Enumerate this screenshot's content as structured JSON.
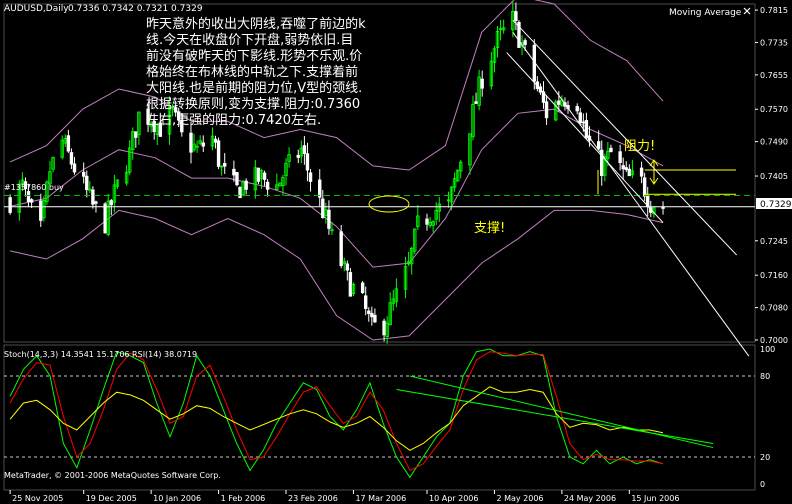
{
  "main_panel": {
    "symbol": "AUDUSD,Daily",
    "ohlc": "0.7336 0.7342 0.7321 0.7329",
    "indicator_label": "Moving Average",
    "close_icon": "close-icon",
    "order_label": "#1357860 buy",
    "price_tag": "0.7329",
    "annotation_lines": [
      "昨天意外的收出大阴线,吞噬了前边的k",
      "线.今天在收盘价下开盘,弱势依旧.目",
      "前没有破昨天的下影线.形势不乐观.价",
      "格始终在布林线的中轨之下.支撑着前",
      "大阳线.也是前期的阻力位,V型的颈线.",
      "根据转换原则,变为支撑.阻力:0.7360",
      "左右,更强的阻力:0.7420左右."
    ],
    "resistance_label": "阻力!",
    "support_label": "支撑!"
  },
  "sub_panel": {
    "header": "Stoch(14,3,3) 14.3541 15.1706  RSI(14) 38.0719",
    "copyright": "MetaTrader, © 2001-2006 MetaQuotes Software Corp."
  },
  "colors": {
    "background": "#000000",
    "bull": "#00ff00",
    "bear": "#ffffff",
    "bollinger": "#c080c0",
    "trendline": "#ffffff",
    "level_line": "#ffff00",
    "stoch_main": "#00ff00",
    "stoch_signal": "#ff0000",
    "rsi": "#ffff00",
    "annotation": "#ffffff",
    "callout": "#ffff00",
    "axis_text": "#ffffff",
    "grid_dotted": "#c8c8c8",
    "order_line": "#00c000"
  },
  "chart_data": [
    {
      "type": "candlestick",
      "title": "AUDUSD,Daily",
      "price_ticks": [
        "0.7815",
        "0.7735",
        "0.7655",
        "0.7570",
        "0.7490",
        "0.7405",
        "0.7329",
        "0.7245",
        "0.7160",
        "0.7080",
        "0.7000"
      ],
      "date_ticks": [
        "25 Nov 2005",
        "19 Dec 2005",
        "10 Jan 2006",
        "1 Feb 2006",
        "23 Feb 2006",
        "17 Mar 2006",
        "10 Apr 2006",
        "2 May 2006",
        "24 May 2006",
        "15 Jun 2006"
      ],
      "ylim": [
        0.6995,
        0.783
      ],
      "last_price": 0.7329,
      "order_price": 0.7357,
      "resistance_levels": [
        0.742,
        0.736
      ],
      "support_level": 0.7329,
      "close_path": [
        {
          "date": "2005-11-25",
          "close": 0.7345
        },
        {
          "date": "2005-11-29",
          "close": 0.738
        },
        {
          "date": "2005-12-01",
          "close": 0.733
        },
        {
          "date": "2005-12-05",
          "close": 0.727
        },
        {
          "date": "2005-12-08",
          "close": 0.742
        },
        {
          "date": "2005-12-12",
          "close": 0.749
        },
        {
          "date": "2005-12-15",
          "close": 0.744
        },
        {
          "date": "2005-12-19",
          "close": 0.738
        },
        {
          "date": "2005-12-22",
          "close": 0.733
        },
        {
          "date": "2005-12-26",
          "close": 0.729
        },
        {
          "date": "2005-12-29",
          "close": 0.736
        },
        {
          "date": "2006-01-03",
          "close": 0.746
        },
        {
          "date": "2006-01-06",
          "close": 0.7555
        },
        {
          "date": "2006-01-10",
          "close": 0.755
        },
        {
          "date": "2006-01-13",
          "close": 0.7525
        },
        {
          "date": "2006-01-17",
          "close": 0.756
        },
        {
          "date": "2006-01-20",
          "close": 0.75
        },
        {
          "date": "2006-01-25",
          "close": 0.747
        },
        {
          "date": "2006-01-30",
          "close": 0.75
        },
        {
          "date": "2006-02-02",
          "close": 0.742
        },
        {
          "date": "2006-02-07",
          "close": 0.737
        },
        {
          "date": "2006-02-10",
          "close": 0.739
        },
        {
          "date": "2006-02-15",
          "close": 0.74
        },
        {
          "date": "2006-02-20",
          "close": 0.738
        },
        {
          "date": "2006-02-23",
          "close": 0.742
        },
        {
          "date": "2006-02-28",
          "close": 0.747
        },
        {
          "date": "2006-03-03",
          "close": 0.74
        },
        {
          "date": "2006-03-07",
          "close": 0.732
        },
        {
          "date": "2006-03-10",
          "close": 0.725
        },
        {
          "date": "2006-03-15",
          "close": 0.715
        },
        {
          "date": "2006-03-20",
          "close": 0.709
        },
        {
          "date": "2006-03-23",
          "close": 0.703
        },
        {
          "date": "2006-03-27",
          "close": 0.704
        },
        {
          "date": "2006-03-30",
          "close": 0.709
        },
        {
          "date": "2006-04-04",
          "close": 0.718
        },
        {
          "date": "2006-04-07",
          "close": 0.728
        },
        {
          "date": "2006-04-12",
          "close": 0.732
        },
        {
          "date": "2006-04-17",
          "close": 0.733
        },
        {
          "date": "2006-04-20",
          "close": 0.742
        },
        {
          "date": "2006-04-25",
          "close": 0.756
        },
        {
          "date": "2006-04-28",
          "close": 0.765
        },
        {
          "date": "2006-05-03",
          "close": 0.774
        },
        {
          "date": "2006-05-08",
          "close": 0.779
        },
        {
          "date": "2006-05-11",
          "close": 0.773
        },
        {
          "date": "2006-05-16",
          "close": 0.762
        },
        {
          "date": "2006-05-19",
          "close": 0.756
        },
        {
          "date": "2006-05-24",
          "close": 0.76
        },
        {
          "date": "2006-05-29",
          "close": 0.759
        },
        {
          "date": "2006-06-01",
          "close": 0.75
        },
        {
          "date": "2006-06-06",
          "close": 0.743
        },
        {
          "date": "2006-06-09",
          "close": 0.746
        },
        {
          "date": "2006-06-14",
          "close": 0.74
        },
        {
          "date": "2006-06-19",
          "close": 0.739
        },
        {
          "date": "2006-06-22",
          "close": 0.734
        },
        {
          "date": "2006-06-26",
          "close": 0.7329
        }
      ],
      "bollinger_upper": [
        0.744,
        0.748,
        0.757,
        0.762,
        0.76,
        0.754,
        0.754,
        0.75,
        0.752,
        0.75,
        0.743,
        0.742,
        0.748,
        0.776,
        0.785,
        0.783,
        0.774,
        0.769,
        0.759
      ],
      "bollinger_middle": [
        0.733,
        0.735,
        0.742,
        0.747,
        0.745,
        0.74,
        0.74,
        0.738,
        0.735,
        0.728,
        0.718,
        0.719,
        0.73,
        0.747,
        0.756,
        0.757,
        0.752,
        0.748,
        0.743
      ],
      "bollinger_lower": [
        0.722,
        0.72,
        0.725,
        0.732,
        0.73,
        0.726,
        0.73,
        0.726,
        0.72,
        0.706,
        0.7,
        0.701,
        0.71,
        0.719,
        0.725,
        0.732,
        0.732,
        0.731,
        0.729
      ],
      "trendlines": [
        {
          "from": {
            "date": "2006-05-08",
            "price": 0.779
          },
          "to": {
            "date": "2006-07-20",
            "price": 0.721
          }
        },
        {
          "from": {
            "date": "2006-05-08",
            "price": 0.776
          },
          "to": {
            "date": "2006-07-24",
            "price": 0.696
          }
        },
        {
          "from": {
            "date": "2006-05-06",
            "price": 0.771
          },
          "to": {
            "date": "2006-06-26",
            "price": 0.729
          }
        }
      ]
    },
    {
      "type": "line",
      "title": "Stoch(14,3,3) 14.3541 15.1706  RSI(14) 38.0719",
      "ylim": [
        0,
        100
      ],
      "y_ticks": [
        "100",
        "80",
        "20",
        "0"
      ],
      "levels": [
        80,
        20
      ],
      "series": [
        {
          "name": "Stoch",
          "values": [
            65,
            85,
            95,
            80,
            30,
            12,
            40,
            70,
            98,
            95,
            90,
            60,
            35,
            60,
            95,
            80,
            55,
            30,
            10,
            25,
            45,
            60,
            75,
            70,
            50,
            40,
            55,
            75,
            45,
            20,
            5,
            20,
            35,
            45,
            80,
            98,
            100,
            95,
            95,
            98,
            95,
            50,
            20,
            15,
            25,
            15,
            20,
            15,
            18,
            15
          ]
        },
        {
          "name": "Stoch signal",
          "values": [
            60,
            78,
            90,
            88,
            50,
            20,
            30,
            55,
            85,
            97,
            92,
            70,
            45,
            50,
            80,
            88,
            65,
            40,
            18,
            20,
            35,
            52,
            68,
            72,
            58,
            45,
            50,
            68,
            55,
            30,
            10,
            15,
            28,
            40,
            70,
            92,
            98,
            97,
            95,
            96,
            96,
            65,
            30,
            18,
            22,
            18,
            18,
            17,
            17,
            15
          ]
        },
        {
          "name": "RSI(14)",
          "values": [
            48,
            60,
            62,
            55,
            45,
            40,
            50,
            60,
            68,
            66,
            62,
            55,
            48,
            52,
            58,
            56,
            50,
            45,
            40,
            44,
            48,
            52,
            55,
            52,
            46,
            42,
            45,
            50,
            42,
            32,
            25,
            30,
            38,
            45,
            58,
            65,
            72,
            68,
            68,
            70,
            68,
            52,
            42,
            45,
            44,
            40,
            42,
            40,
            40,
            38
          ]
        }
      ],
      "trendlines": [
        {
          "from": {
            "index": 29,
            "value": 70
          },
          "to": {
            "index": 49,
            "value": 30
          }
        },
        {
          "from": {
            "index": 30,
            "value": 80
          },
          "to": {
            "index": 49,
            "value": 27
          }
        }
      ]
    }
  ]
}
